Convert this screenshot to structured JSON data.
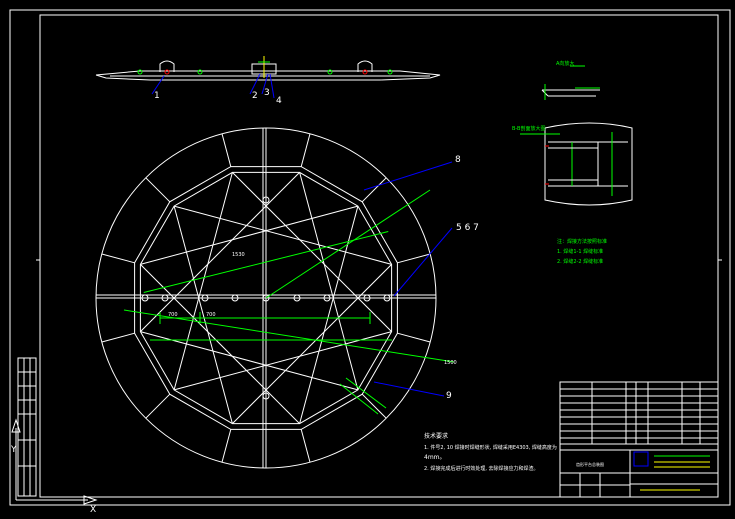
{
  "drawing": {
    "callouts": {
      "c1": "1",
      "c2": "2",
      "c3": "3",
      "c4": "4",
      "c8": "8",
      "c567": "5 6 7",
      "c9": "9"
    },
    "dimensions": {
      "d1": "700",
      "d2": "700",
      "d3": "1530",
      "d4": "1500"
    },
    "notes": {
      "heading": "技术要求",
      "line1": "1. 件号2, 10 焊接时焊缝形状, 焊缝采用E4303, 焊缝高度为",
      "line2": "4mm。",
      "line3": "2. 焊接完成后进行时效处理, 去除焊接应力和焊渣。"
    },
    "side_notes": {
      "heading": "注：焊接方法按照标准",
      "line1": "1. 焊缝1-1 焊缝标准",
      "line2": "2. 焊缝2-2 焊缝标准"
    },
    "detail_labels": {
      "detail_a": "A向放大",
      "section_b": "B-B剖面放大图"
    },
    "title_block": {
      "drawing_title": "齿形平台总装图"
    }
  },
  "colors": {
    "background": "#000000",
    "lines": "#ffffff",
    "dimension": "#00ff00",
    "leader": "#0000ff",
    "text": "#ffff00",
    "mark": "#ff0000"
  }
}
